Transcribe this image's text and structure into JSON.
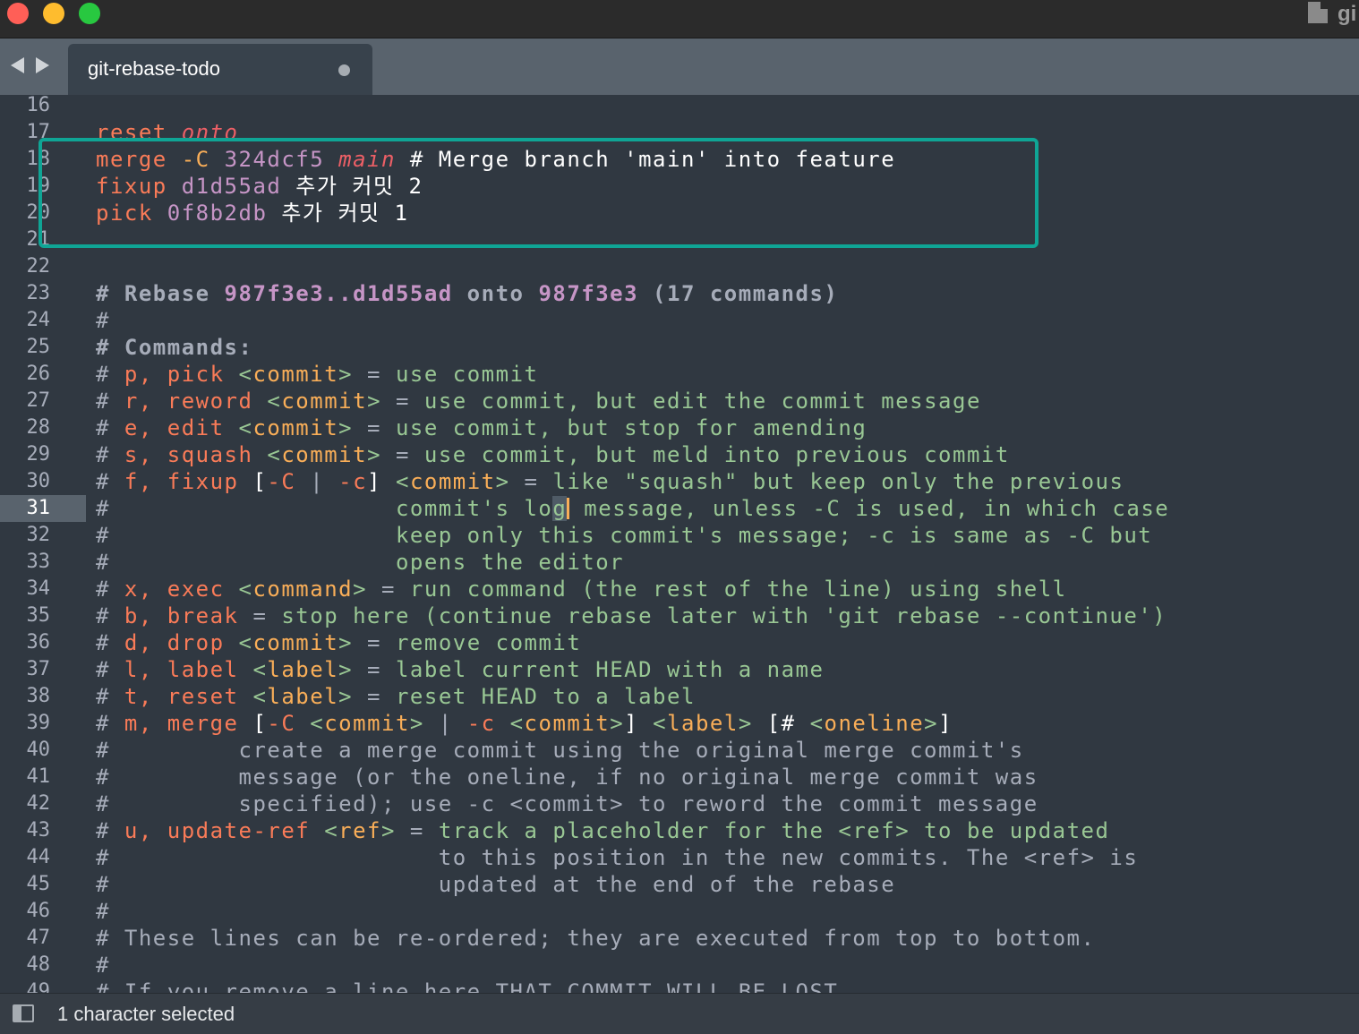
{
  "window": {
    "title_partial": "gi"
  },
  "tab": {
    "label": "git-rebase-todo"
  },
  "status": {
    "text": "1 character selected"
  },
  "colors": {
    "annotation_box": "#0fa595",
    "editor_bg": "#303841",
    "cursor": "#f9ae58"
  },
  "editor": {
    "active_line": 31,
    "line_numbers": [
      "16",
      "17",
      "18",
      "19",
      "20",
      "21",
      "22",
      "23",
      "24",
      "25",
      "26",
      "27",
      "28",
      "29",
      "30",
      "31",
      "32",
      "33",
      "34",
      "35",
      "36",
      "37",
      "38",
      "39",
      "40",
      "41",
      "42",
      "43",
      "44",
      "45",
      "46",
      "47",
      "48",
      "49"
    ],
    "l17": {
      "a": "reset ",
      "b": "onto"
    },
    "l18": {
      "a": "merge ",
      "b": "-C ",
      "c": "324dcf5 ",
      "d": "main",
      "e": " # Merge branch 'main' into feature"
    },
    "l19": {
      "a": "fixup ",
      "b": "d1d55ad ",
      "c": "추가 커밋 2"
    },
    "l20": {
      "a": "pick ",
      "b": "0f8b2db ",
      "c": "추가 커밋 1"
    },
    "l23": {
      "a": "# Rebase ",
      "b": "987f3e3..d1d55ad",
      "c": " onto ",
      "d": "987f3e3",
      "e": " (17 commands)"
    },
    "l24": "#",
    "l25": "# Commands:",
    "l26": {
      "a": "# ",
      "b": "p, pick ",
      "c": "<",
      "d": "commit",
      "e": ">",
      "f": " = ",
      "g": "use commit"
    },
    "l27": {
      "a": "# ",
      "b": "r, reword ",
      "c": "<",
      "d": "commit",
      "e": ">",
      "f": " = ",
      "g": "use commit, but edit the commit message"
    },
    "l28": {
      "a": "# ",
      "b": "e, edit ",
      "c": "<",
      "d": "commit",
      "e": ">",
      "f": " = ",
      "g": "use commit, but stop for amending"
    },
    "l29": {
      "a": "# ",
      "b": "s, squash ",
      "c": "<",
      "d": "commit",
      "e": ">",
      "f": " = ",
      "g": "use commit, but meld into previous commit"
    },
    "l30": {
      "a": "# ",
      "b": "f, fixup ",
      "c": "[",
      "d": "-C",
      "e": " | ",
      "f": "-c",
      "g": "] ",
      "h": "<",
      "i": "commit",
      "j": ">",
      "k": " = ",
      "l": "like \"squash\" but keep only the previous"
    },
    "l31": {
      "a": "#",
      "b": "                    ",
      "c": "commit's lo",
      "d": "g",
      "e": " message, unless -C is used, in which case"
    },
    "l32": {
      "a": "#",
      "b": "                    ",
      "c": "keep only this commit's message; -c is same as -C but"
    },
    "l33": {
      "a": "#",
      "b": "                    ",
      "c": "opens the editor"
    },
    "l34": {
      "a": "# ",
      "b": "x, exec ",
      "c": "<",
      "d": "command",
      "e": ">",
      "f": " = ",
      "g": "run command (the rest of the line) using shell"
    },
    "l35": {
      "a": "# ",
      "b": "b, break",
      "f": " = ",
      "g": "stop here (continue rebase later with 'git rebase --continue')"
    },
    "l36": {
      "a": "# ",
      "b": "d, drop ",
      "c": "<",
      "d": "commit",
      "e": ">",
      "f": " = ",
      "g": "remove commit"
    },
    "l37": {
      "a": "# ",
      "b": "l, label ",
      "c": "<",
      "d": "label",
      "e": ">",
      "f": " = ",
      "g": "label current HEAD with a name"
    },
    "l38": {
      "a": "# ",
      "b": "t, reset ",
      "c": "<",
      "d": "label",
      "e": ">",
      "f": " = ",
      "g": "reset HEAD to a label"
    },
    "l39": {
      "a": "# ",
      "b": "m, merge ",
      "c": "[",
      "d": "-C ",
      "e": "<",
      "f": "commit",
      "g": ">",
      "h": " | ",
      "i": "-c ",
      "j": "<",
      "k": "commit",
      "l": ">",
      "m": "] ",
      "n": "<",
      "o": "label",
      "p": ">",
      "q": " [# ",
      "r": "<",
      "s": "oneline",
      "t": ">",
      "u": "]"
    },
    "l40": "#         create a merge commit using the original merge commit's",
    "l41": "#         message (or the oneline, if no original merge commit was",
    "l42": "#         specified); use -c <commit> to reword the commit message",
    "l43": {
      "a": "# ",
      "b": "u, update-ref ",
      "c": "<",
      "d": "ref",
      "e": ">",
      "f": " = ",
      "g": "track a placeholder for the <ref> to be updated"
    },
    "l44": {
      "a": "#",
      "b": "                       ",
      "c": "to this position in the new commits. The <ref> is"
    },
    "l45": {
      "a": "#",
      "b": "                       ",
      "c": "updated at the end of the rebase"
    },
    "l46": "#",
    "l47": "# These lines can be re-ordered; they are executed from top to bottom.",
    "l48": "#",
    "l49": "# If you remove a line here THAT COMMIT WILL BE LOST."
  }
}
